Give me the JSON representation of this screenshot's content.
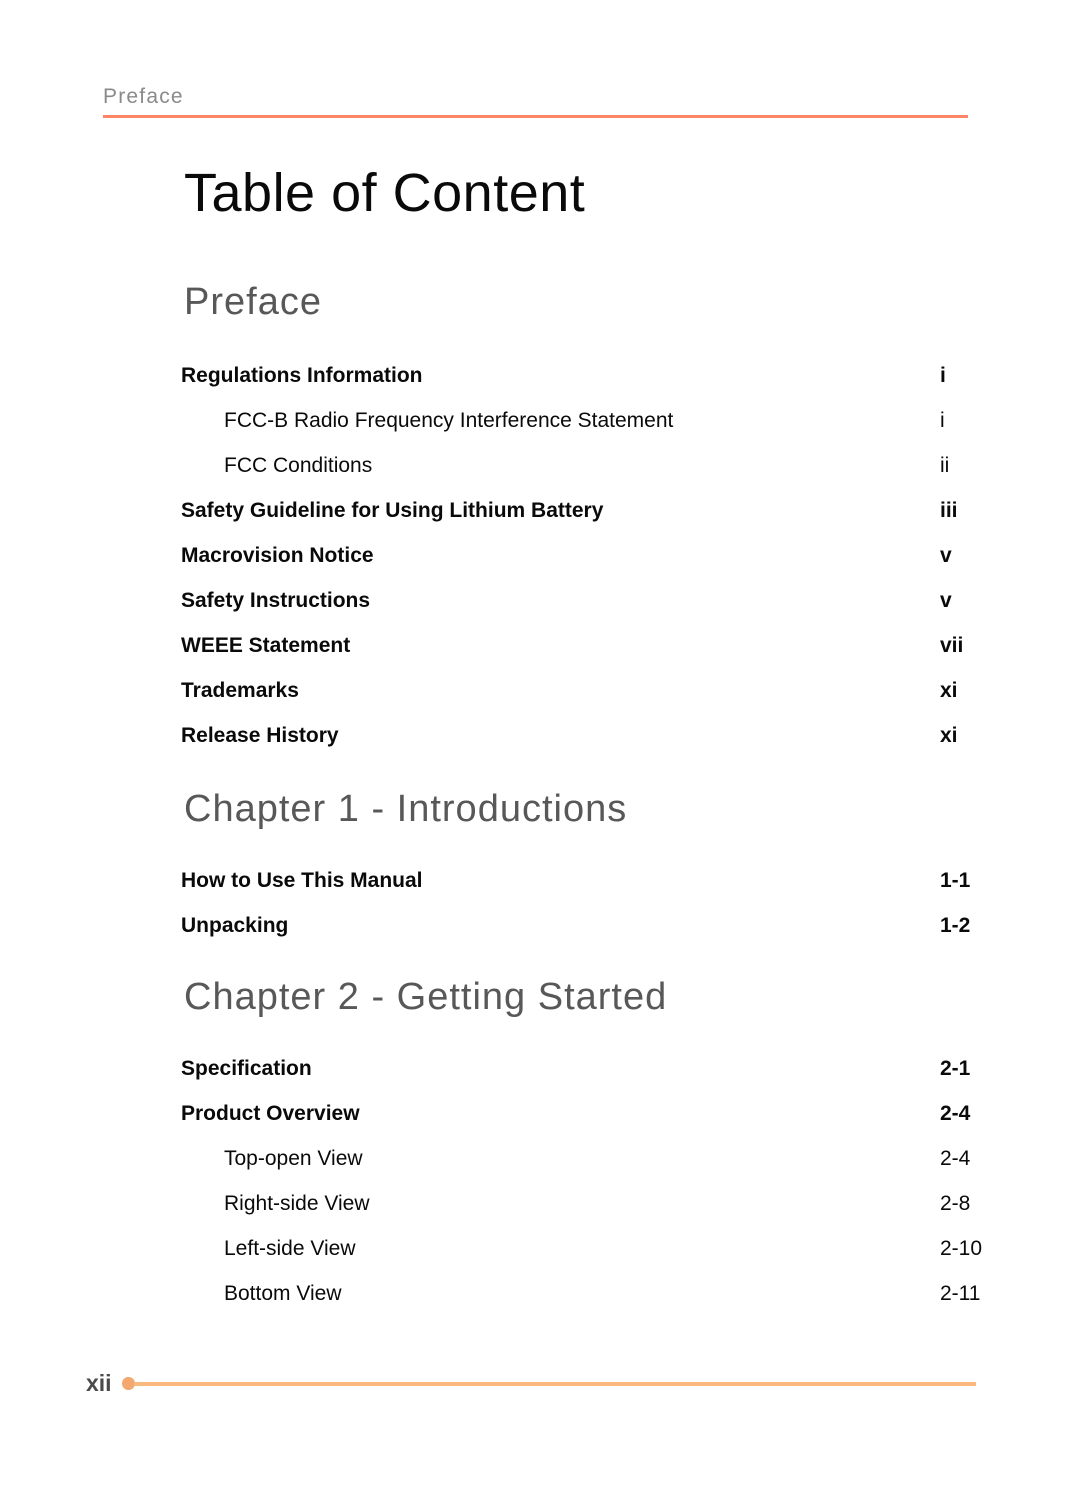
{
  "header": {
    "running_title": "Preface",
    "rule_color": "#ff8566"
  },
  "doc_title": "Table of Content",
  "sections": [
    {
      "heading": "Preface",
      "entries": [
        {
          "label": "Regulations Information",
          "page": "i",
          "level": 1
        },
        {
          "label": "FCC-B Radio Frequency Interference Statement",
          "page": "i",
          "level": 2
        },
        {
          "label": "FCC Conditions",
          "page": "ii",
          "level": 2
        },
        {
          "label": "Safety Guideline for Using Lithium Battery",
          "page": "iii",
          "level": 1
        },
        {
          "label": "Macrovision Notice",
          "page": "v",
          "level": 1
        },
        {
          "label": "Safety Instructions",
          "page": "v",
          "level": 1
        },
        {
          "label": "WEEE Statement",
          "page": "vii",
          "level": 1
        },
        {
          "label": "Trademarks",
          "page": "xi",
          "level": 1
        },
        {
          "label": "Release History",
          "page": "xi",
          "level": 1
        }
      ]
    },
    {
      "heading": "Chapter 1 - Introductions",
      "entries": [
        {
          "label": "How to Use This Manual",
          "page": "1-1",
          "level": 1
        },
        {
          "label": "Unpacking",
          "page": "1-2",
          "level": 1
        }
      ]
    },
    {
      "heading": "Chapter 2 - Getting Started",
      "entries": [
        {
          "label": "Specification",
          "page": "2-1",
          "level": 1
        },
        {
          "label": "Product Overview",
          "page": "2-4",
          "level": 1
        },
        {
          "label": "Top-open View",
          "page": "2-4",
          "level": 2
        },
        {
          "label": "Right-side View",
          "page": "2-8",
          "level": 2
        },
        {
          "label": "Left-side View",
          "page": "2-10",
          "level": 2
        },
        {
          "label": "Bottom View",
          "page": "2-11",
          "level": 2
        }
      ]
    }
  ],
  "footer": {
    "page_number": "xii",
    "dot_color": "#f2a86e",
    "rule_color": "#f8b87e"
  },
  "layout": {
    "section_heading_tops": [
      283,
      790,
      978
    ],
    "section_entries_tops": [
      365,
      870,
      1058
    ]
  }
}
